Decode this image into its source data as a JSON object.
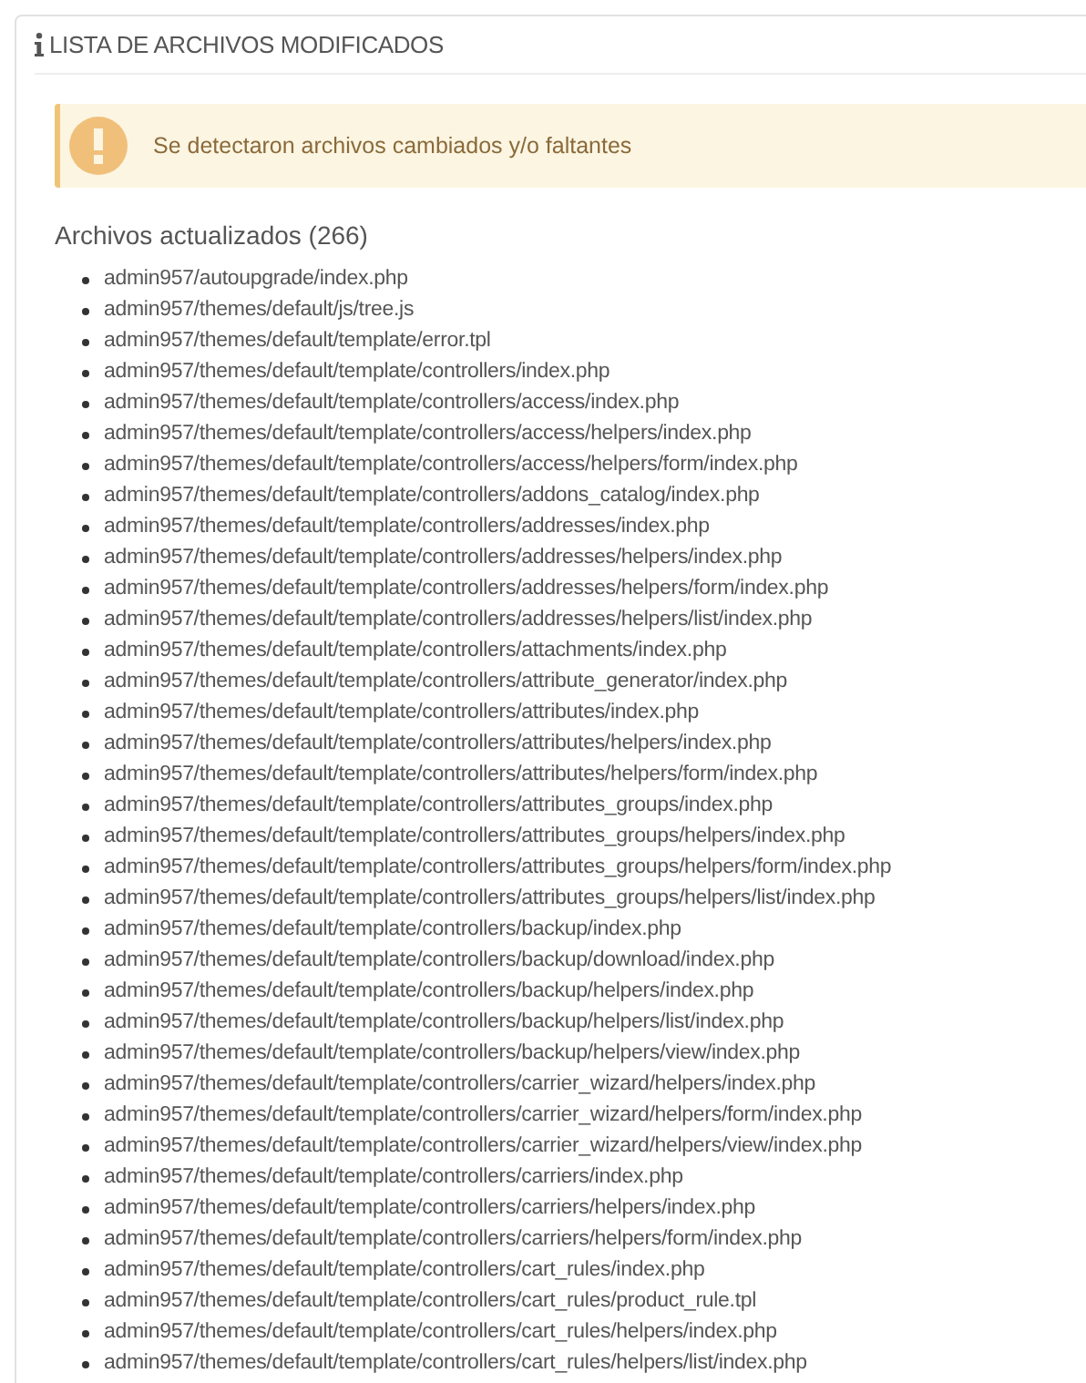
{
  "panel": {
    "title": "LISTA DE ARCHIVOS MODIFICADOS"
  },
  "alert": {
    "message": "Se detectaron archivos cambiados y/o faltantes"
  },
  "section": {
    "heading": "Archivos actualizados (266)",
    "files": [
      "admin957/autoupgrade/index.php",
      "admin957/themes/default/js/tree.js",
      "admin957/themes/default/template/error.tpl",
      "admin957/themes/default/template/controllers/index.php",
      "admin957/themes/default/template/controllers/access/index.php",
      "admin957/themes/default/template/controllers/access/helpers/index.php",
      "admin957/themes/default/template/controllers/access/helpers/form/index.php",
      "admin957/themes/default/template/controllers/addons_catalog/index.php",
      "admin957/themes/default/template/controllers/addresses/index.php",
      "admin957/themes/default/template/controllers/addresses/helpers/index.php",
      "admin957/themes/default/template/controllers/addresses/helpers/form/index.php",
      "admin957/themes/default/template/controllers/addresses/helpers/list/index.php",
      "admin957/themes/default/template/controllers/attachments/index.php",
      "admin957/themes/default/template/controllers/attribute_generator/index.php",
      "admin957/themes/default/template/controllers/attributes/index.php",
      "admin957/themes/default/template/controllers/attributes/helpers/index.php",
      "admin957/themes/default/template/controllers/attributes/helpers/form/index.php",
      "admin957/themes/default/template/controllers/attributes_groups/index.php",
      "admin957/themes/default/template/controllers/attributes_groups/helpers/index.php",
      "admin957/themes/default/template/controllers/attributes_groups/helpers/form/index.php",
      "admin957/themes/default/template/controllers/attributes_groups/helpers/list/index.php",
      "admin957/themes/default/template/controllers/backup/index.php",
      "admin957/themes/default/template/controllers/backup/download/index.php",
      "admin957/themes/default/template/controllers/backup/helpers/index.php",
      "admin957/themes/default/template/controllers/backup/helpers/list/index.php",
      "admin957/themes/default/template/controllers/backup/helpers/view/index.php",
      "admin957/themes/default/template/controllers/carrier_wizard/helpers/index.php",
      "admin957/themes/default/template/controllers/carrier_wizard/helpers/form/index.php",
      "admin957/themes/default/template/controllers/carrier_wizard/helpers/view/index.php",
      "admin957/themes/default/template/controllers/carriers/index.php",
      "admin957/themes/default/template/controllers/carriers/helpers/index.php",
      "admin957/themes/default/template/controllers/carriers/helpers/form/index.php",
      "admin957/themes/default/template/controllers/cart_rules/index.php",
      "admin957/themes/default/template/controllers/cart_rules/product_rule.tpl",
      "admin957/themes/default/template/controllers/cart_rules/helpers/index.php",
      "admin957/themes/default/template/controllers/cart_rules/helpers/list/index.php"
    ]
  }
}
